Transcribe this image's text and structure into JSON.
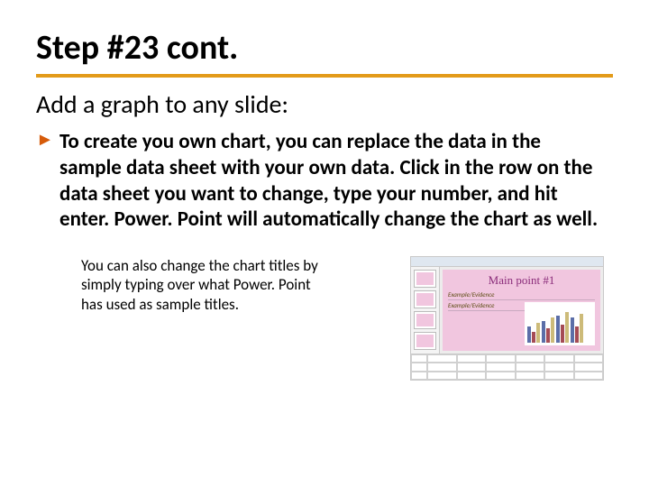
{
  "title": "Step #23 cont.",
  "subtitle": "Add a graph to any slide:",
  "body_text": "To create you own chart, you can replace the data in the sample data sheet with your own data. Click in the row on the data sheet you want to change, type your number, and hit enter. Power. Point will automatically change the chart as well.",
  "footer_text": "You can also change the chart titles by simply typing over what Power. Point has used as sample titles.",
  "thumbnail": {
    "slide_title": "Main point #1",
    "line1": "Example/Evidence",
    "line2": "Example/Evidence"
  },
  "colors": {
    "rule": "#e39b1a",
    "bullet": "#d65b0a"
  }
}
